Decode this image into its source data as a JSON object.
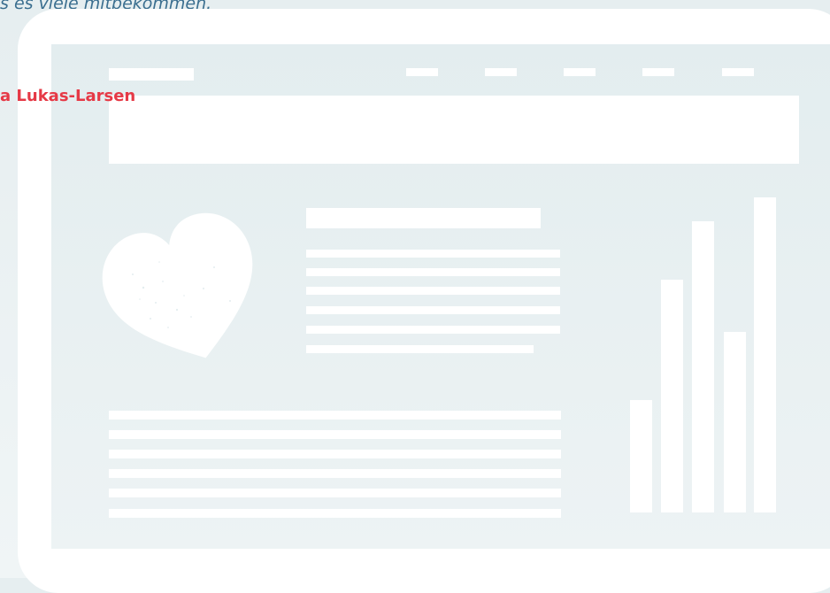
{
  "quote": {
    "text": "s es viele mitbekommen."
  },
  "author": {
    "name": "a Lukas-Larsen"
  },
  "illustration": {
    "icons": [
      "heart-icon",
      "bar-chart-icon"
    ],
    "colors": {
      "background": "#e6eef0",
      "frame": "#ffffff",
      "screen": "#e3edef",
      "quote_text": "#3a6e8f",
      "author_text": "#e63946"
    },
    "bar_chart": {
      "bar_count": 5
    }
  }
}
